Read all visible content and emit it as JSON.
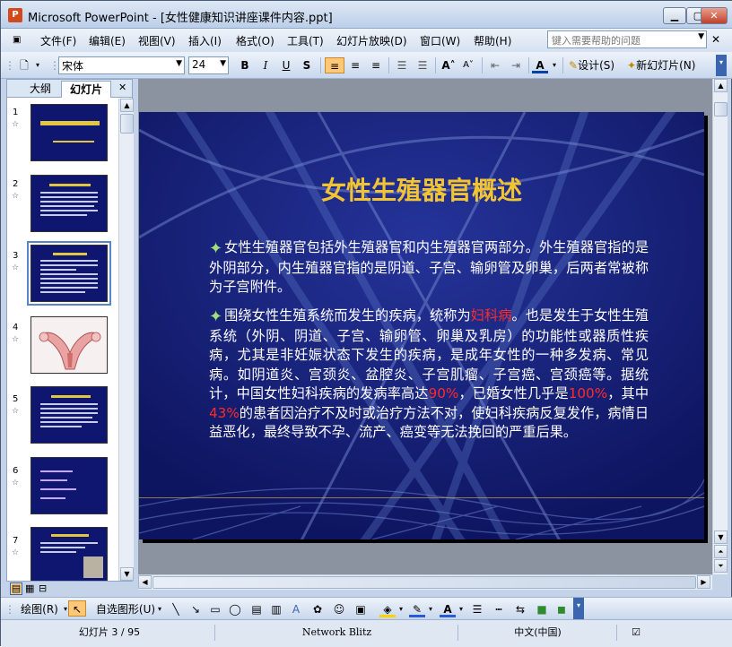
{
  "window": {
    "title": "Microsoft PowerPoint - [女性健康知识讲座课件内容.ppt]",
    "app_icon": "P",
    "min": "▁",
    "max": "▢",
    "close": "✕"
  },
  "menu": {
    "items": [
      "文件(F)",
      "编辑(E)",
      "视图(V)",
      "插入(I)",
      "格式(O)",
      "工具(T)",
      "幻灯片放映(D)",
      "窗口(W)",
      "帮助(H)"
    ],
    "help_placeholder": "键入需要帮助的问题",
    "close": "✕"
  },
  "toolbar": {
    "font": "宋体",
    "size": "24",
    "bold": "B",
    "italic": "I",
    "underline": "U",
    "shadow": "S",
    "design": "设计(S)",
    "new_slide": "新幻灯片(N)",
    "font_color_glyph": "A"
  },
  "left_pane": {
    "tabs": [
      "大纲",
      "幻灯片"
    ],
    "tab_close": "✕",
    "slides": [
      {
        "num": "1",
        "kind": "title"
      },
      {
        "num": "2",
        "kind": "text"
      },
      {
        "num": "3",
        "kind": "text",
        "selected": true
      },
      {
        "num": "4",
        "kind": "image"
      },
      {
        "num": "5",
        "kind": "text"
      },
      {
        "num": "6",
        "kind": "bullets"
      },
      {
        "num": "7",
        "kind": "photo"
      }
    ]
  },
  "slide": {
    "title": "女性生殖器官概述",
    "para1": "女性生殖器官包括外生殖器官和内生殖器官两部分。外生殖器官指的是外阴部分，内生殖器官指的是阴道、子宫、输卵管及卵巢，后两者常被称为子宫附件。",
    "para2_a": "围绕女性生殖系统而发生的疾病，统称为",
    "para2_red1": "妇科病",
    "para2_b": "。也是发生于女性生殖系统（外阴、阴道、子宫、输卵管、卵巢及乳房）的功能性或器质性疾病，尤其是非妊娠状态下发生的疾病，是成年女性的一种多发病、常见病。如阴道炎、宫颈炎、盆腔炎、子宫肌瘤、子宫癌、宫颈癌等。据统计，中国女性妇科疾病的发病率高达",
    "para2_red2": "90%",
    "para2_c": "，已婚女性几乎是",
    "para2_red3": "100%",
    "para2_d": "，其中",
    "para2_red4": "43%",
    "para2_e": "的患者因治疗不及时或治疗方法不对，使妇科疾病反复发作，病情日益恶化，最终导致不孕、流产、癌变等无法挽回的严重后果。"
  },
  "drawbar": {
    "draw": "绘图(R)",
    "autoshapes": "自选图形(U)"
  },
  "status": {
    "slide": "幻灯片 3 / 95",
    "template": "Network Blitz",
    "lang": "中文(中国)"
  }
}
